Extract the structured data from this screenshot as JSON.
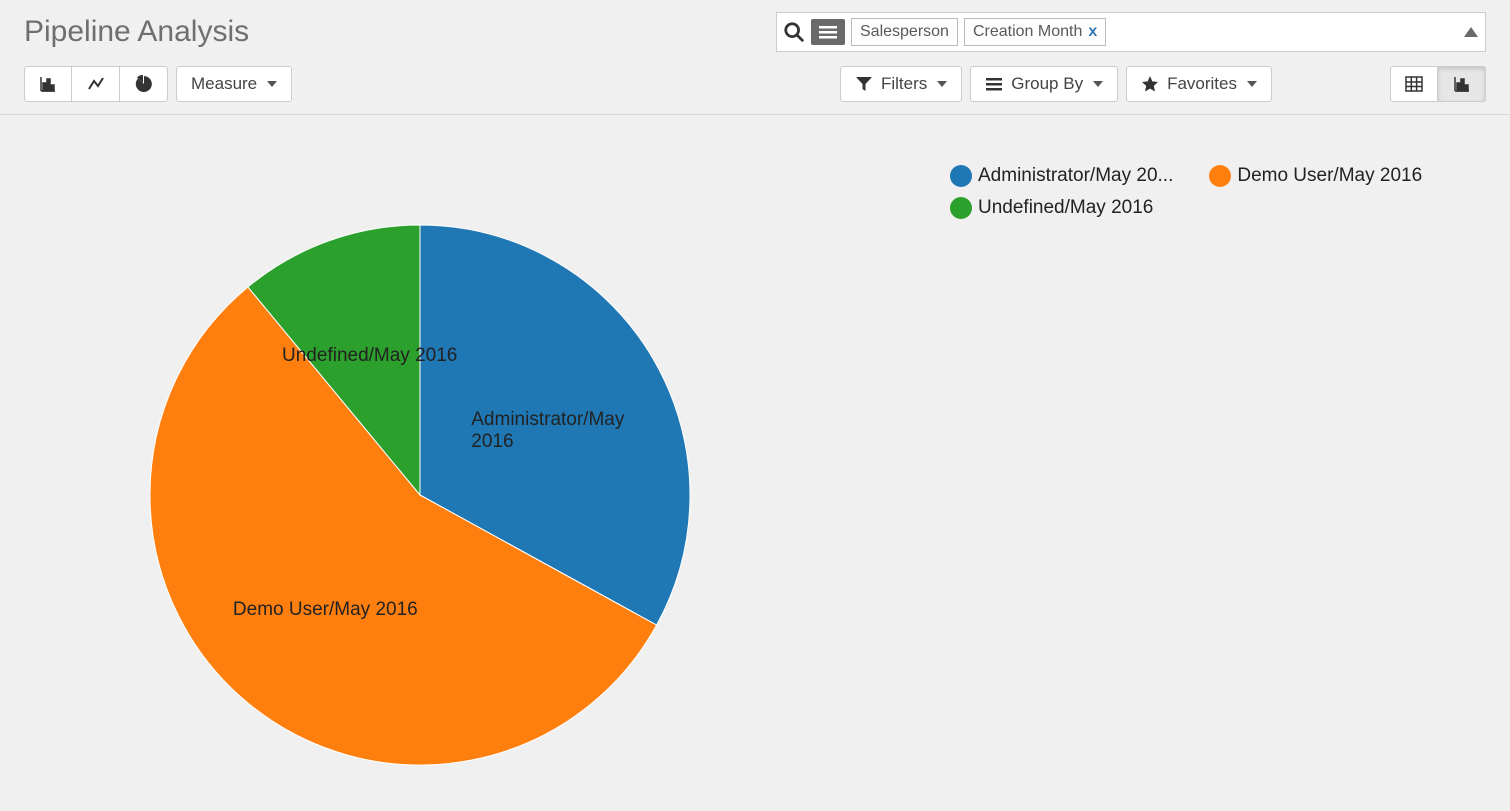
{
  "page": {
    "title": "Pipeline Analysis"
  },
  "search": {
    "groupby_facets": [
      {
        "label": "Salesperson"
      },
      {
        "label": "Creation Month"
      }
    ]
  },
  "toolbar": {
    "measure_label": "Measure",
    "filters_label": "Filters",
    "groupby_label": "Group By",
    "favorites_label": "Favorites"
  },
  "colors": {
    "admin": "#1f77b4",
    "demo": "#ff7f0e",
    "undef": "#2ca02c"
  },
  "chart_data": {
    "type": "pie",
    "title": "",
    "series": [
      {
        "name": "Administrator/May 2016",
        "legend_label": "Administrator/May 20...",
        "value": 33,
        "color": "#1f77b4"
      },
      {
        "name": "Demo User/May 2016",
        "legend_label": "Demo User/May 2016",
        "value": 56,
        "color": "#ff7f0e"
      },
      {
        "name": "Undefined/May 2016",
        "legend_label": "Undefined/May 2016",
        "value": 11,
        "color": "#2ca02c"
      }
    ]
  }
}
